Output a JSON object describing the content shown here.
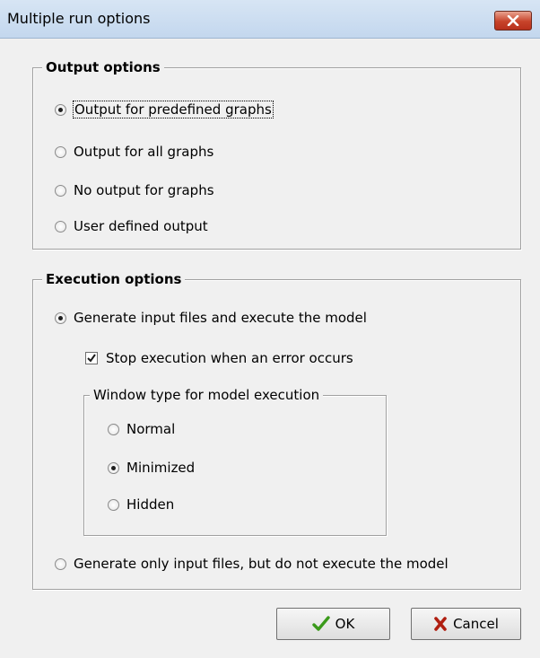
{
  "window": {
    "title": "Multiple run options",
    "close_icon": "close-icon"
  },
  "output_options": {
    "legend": "Output options",
    "items": [
      {
        "label": "Output for predefined graphs",
        "checked": true
      },
      {
        "label": "Output for all graphs",
        "checked": false
      },
      {
        "label": "No output for graphs",
        "checked": false
      },
      {
        "label": "User defined output",
        "checked": false
      }
    ]
  },
  "execution_options": {
    "legend": "Execution options",
    "generate_execute_label": "Generate input files and execute the model",
    "generate_execute_checked": true,
    "stop_on_error_label": "Stop execution when an error occurs",
    "stop_on_error_checked": true,
    "window_type": {
      "legend": "Window type for model execution",
      "items": [
        {
          "label": "Normal",
          "checked": false
        },
        {
          "label": "Minimized",
          "checked": true
        },
        {
          "label": "Hidden",
          "checked": false
        }
      ]
    },
    "generate_only_label": "Generate only input files, but do not execute the model",
    "generate_only_checked": false
  },
  "buttons": {
    "ok_label": "OK",
    "ok_icon": "checkmark-icon",
    "cancel_label": "Cancel",
    "cancel_icon": "x-icon",
    "ok_icon_color": "#3a9a1a",
    "cancel_icon_color": "#b01e10"
  }
}
